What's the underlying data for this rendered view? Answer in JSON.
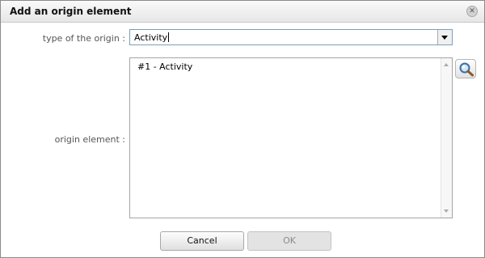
{
  "dialog": {
    "title": "Add an origin element",
    "close_icon": "close-icon"
  },
  "form": {
    "type_label": "type of the origin :",
    "type_value": "Activity",
    "element_label": "origin element :",
    "elements": [
      "#1 - Activity"
    ],
    "search_icon": "magnifier-icon"
  },
  "buttons": {
    "cancel": "Cancel",
    "ok": "OK",
    "ok_enabled": false
  }
}
